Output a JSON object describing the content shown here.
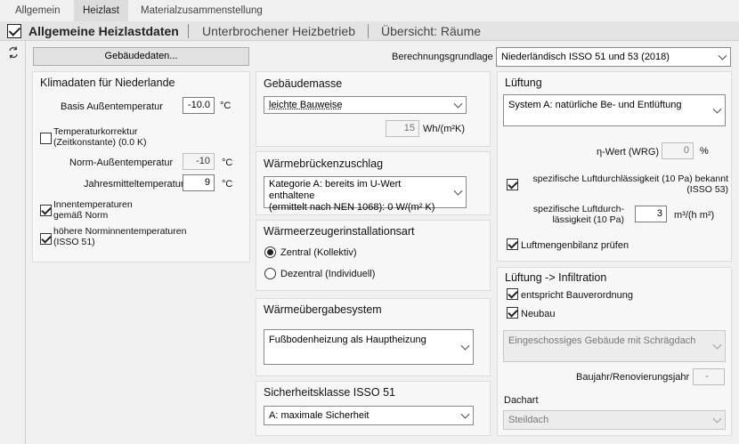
{
  "tabs": [
    {
      "label": "Allgemein"
    },
    {
      "label": "Heizlast"
    },
    {
      "label": "Materialzusammenstellung"
    }
  ],
  "header": {
    "checked": true,
    "title": "Allgemeine Heizlastdaten",
    "link1": "Unterbrochener Heizbetrieb",
    "link2": "Übersicht: Räume"
  },
  "buttons": {
    "building": "Gebäudedaten..."
  },
  "basis": {
    "label": "Berechnungsgrundlage",
    "value": "Niederländisch ISSO 51 und 53 (2018)"
  },
  "klima": {
    "title": "Klimadaten für Niederlande",
    "basis_label": "Basis Außentemperatur",
    "basis_value": "-10.0",
    "basis_unit": "°C",
    "temp_corr_label1": "Temperaturkorrektur",
    "temp_corr_label2": "(Zeitkonstante) (0.0 K)",
    "temp_corr_checked": false,
    "norm_label": "Norm-Außentemperatur",
    "norm_value": "-10",
    "norm_unit": "°C",
    "jahr_label": "Jahresmitteltemperatur",
    "jahr_value": "9",
    "jahr_unit": "°C",
    "innen_label1": "Innentemperaturen",
    "innen_label2": "gemäß Norm",
    "innen_checked": true,
    "hoehere_label1": "höhere Norminnentemperaturen",
    "hoehere_label2": "(ISSO 51)",
    "hoehere_checked": true
  },
  "masse": {
    "title": "Gebäudemasse",
    "value": "leichte Bauweise",
    "num": "15",
    "unit": "Wh/(m²K)"
  },
  "wbz": {
    "title": "Wärmebrückenzuschlag",
    "line1": "Kategorie A: bereits im U-Wert enthaltene",
    "line2": "(ermittelt nach NEN 1068): 0 W/(m² K)"
  },
  "wea": {
    "title": "Wärmeerzeugerinstallationsart",
    "opt1": "Zentral (Kollektiv)",
    "opt2": "Dezentral (Individuell)",
    "selected": "opt1"
  },
  "wue": {
    "title": "Wärmeübergabesystem",
    "value": "Fußbodenheizung als Hauptheizung"
  },
  "sich": {
    "title": "Sicherheitsklasse ISSO 51",
    "value": "A: maximale Sicherheit"
  },
  "lueftung": {
    "title": "Lüftung",
    "system": "System A: natürliche Be- und Entlüftung",
    "eta_label": "η-Wert (WRG)",
    "eta_value": "0",
    "eta_unit": "%",
    "spez_check_label1": "spezifische Luftdurchlässigkeit (10 Pa) bekannt",
    "spez_check_label2": "(ISSO 53)",
    "spez_checked": true,
    "spez_label1": "spezifische Luftdurch-",
    "spez_label2": "lässigkeit (10 Pa)",
    "spez_value": "3",
    "spez_unit": "m³/(h m²)",
    "bilanz_label": "Luftmengenbilanz prüfen",
    "bilanz_checked": true
  },
  "infil": {
    "title": "Lüftung -> Infiltration",
    "bau_label": "entspricht Bauverordnung",
    "bau_checked": true,
    "neubau_label": "Neubau",
    "neubau_checked": true,
    "gebaeude": "Eingeschossiges Gebäude mit Schrägdach",
    "baujahr_label": "Baujahr/Renovierungsjahr",
    "baujahr_value": "-",
    "dach_label": "Dachart",
    "dach_value": "Steildach"
  }
}
